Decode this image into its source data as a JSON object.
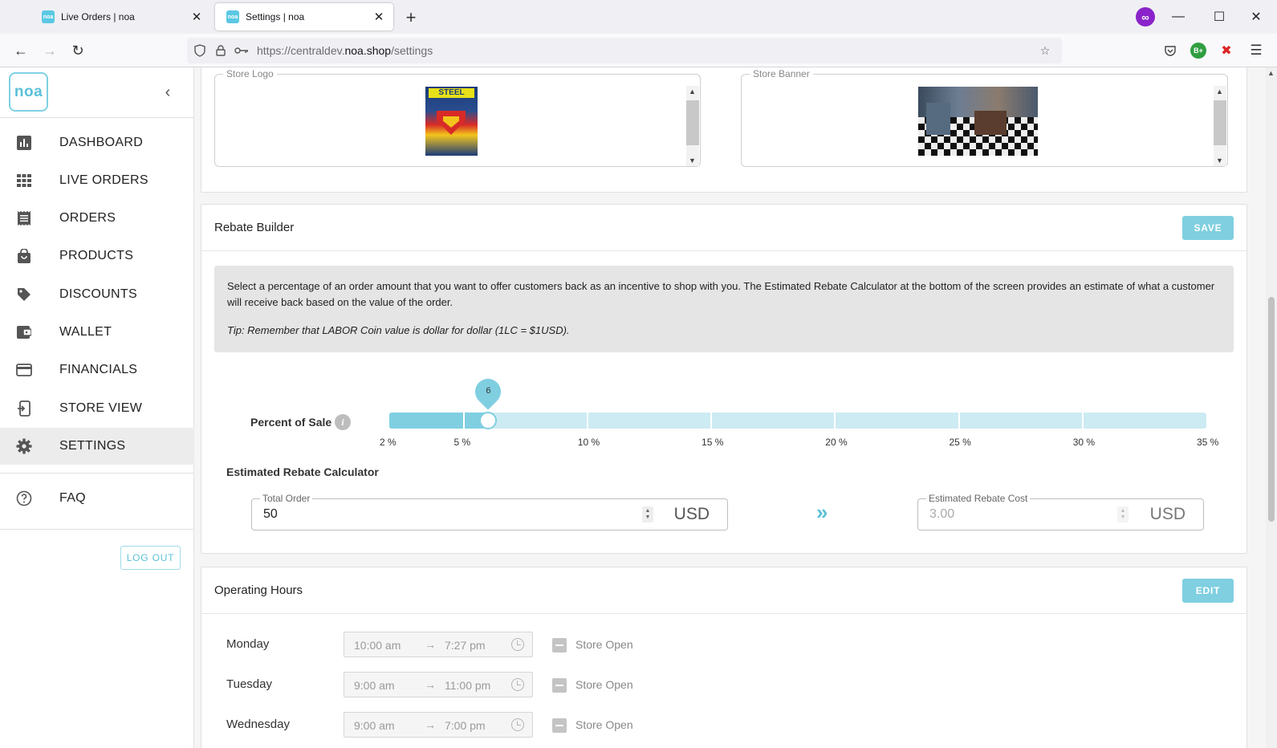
{
  "browser": {
    "tabs": [
      {
        "favicon": "noa",
        "title": "Live Orders | noa"
      },
      {
        "favicon": "noa",
        "title": "Settings | noa"
      }
    ],
    "url_prefix": "https://centraldev.",
    "url_domain": "noa.shop",
    "url_path": "/settings"
  },
  "sidebar": {
    "logo": "noa",
    "items": [
      {
        "label": "DASHBOARD",
        "icon": "bar-chart-icon"
      },
      {
        "label": "LIVE ORDERS",
        "icon": "grid-icon"
      },
      {
        "label": "ORDERS",
        "icon": "receipt-icon"
      },
      {
        "label": "PRODUCTS",
        "icon": "shopping-bag-icon"
      },
      {
        "label": "DISCOUNTS",
        "icon": "tag-icon"
      },
      {
        "label": "WALLET",
        "icon": "wallet-icon"
      },
      {
        "label": "FINANCIALS",
        "icon": "credit-card-icon"
      },
      {
        "label": "STORE VIEW",
        "icon": "store-view-icon"
      },
      {
        "label": "SETTINGS",
        "icon": "gear-icon",
        "active": true
      }
    ],
    "faq": {
      "label": "FAQ",
      "icon": "help-circle-icon"
    },
    "logout_label": "LOG OUT"
  },
  "store_images": {
    "logo_label": "Store Logo",
    "banner_label": "Store Banner"
  },
  "rebate_builder": {
    "title": "Rebate Builder",
    "save_label": "SAVE",
    "description": "Select a percentage of an order amount that you want to offer customers back as an incentive to shop with you. The Estimated Rebate Calculator at the bottom of the screen provides an estimate of what a customer will receive back based on the value of the order.",
    "tip": "Tip: Remember that LABOR Coin value is dollar for dollar (1LC = $1USD).",
    "percent_label": "Percent of Sale",
    "slider": {
      "min": 2,
      "max": 35,
      "value": 6,
      "value_label": "6"
    },
    "ticks": [
      "2 %",
      "5 %",
      "10 %",
      "15 %",
      "20 %",
      "25 %",
      "30 %",
      "35 %"
    ],
    "calculator_title": "Estimated Rebate Calculator",
    "total_order": {
      "label": "Total Order",
      "value": "50",
      "unit": "USD"
    },
    "estimated_cost": {
      "label": "Estimated Rebate Cost",
      "value": "3.00",
      "unit": "USD"
    }
  },
  "operating_hours": {
    "title": "Operating Hours",
    "edit_label": "EDIT",
    "days": [
      {
        "day": "Monday",
        "open": "10:00 am",
        "close": "7:27 pm",
        "status": "Store Open"
      },
      {
        "day": "Tuesday",
        "open": "9:00 am",
        "close": "11:00 pm",
        "status": "Store Open"
      },
      {
        "day": "Wednesday",
        "open": "9:00 am",
        "close": "7:00 pm",
        "status": "Store Open"
      }
    ]
  },
  "colors": {
    "accent": "#7fcfe0",
    "accent_dark": "#5bc0d9",
    "track": "#cdebf3"
  }
}
